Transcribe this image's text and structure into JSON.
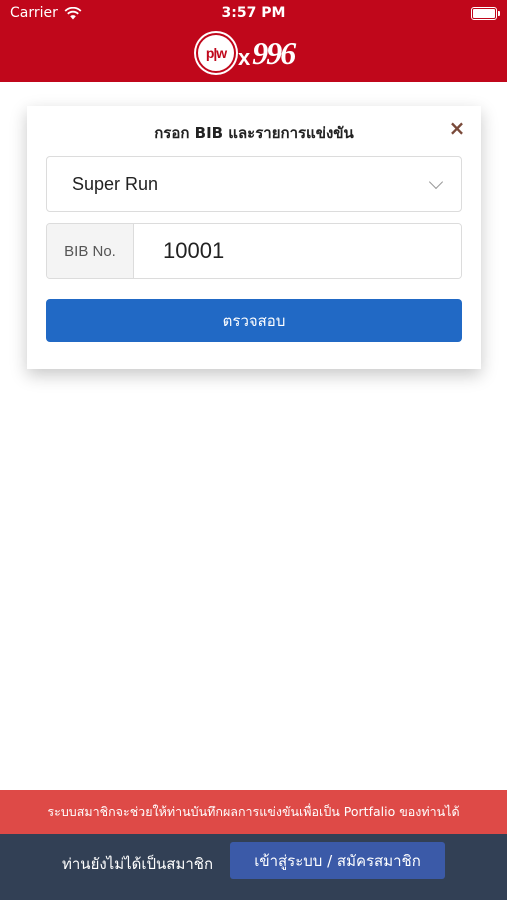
{
  "status_bar": {
    "carrier": "Carrier",
    "time": "3:57 PM"
  },
  "header": {
    "logo_left": "p|w",
    "logo_x": "x",
    "logo_right": "996",
    "brand_color": "#c0071b"
  },
  "dialog": {
    "title": "กรอก BIB และรายการแข่งขัน",
    "close_icon": "×",
    "race_select": {
      "selected": "Super Run"
    },
    "bib": {
      "label": "BIB No.",
      "value": "10001"
    },
    "check_button": "ตรวจสอบ",
    "accent_color": "#2169c5"
  },
  "info_banner": {
    "text": "ระบบสมาชิกจะช่วยให้ท่านบันทึกผลการแข่งขันเพื่อเป็น Portfalio ของท่านได้",
    "color": "#de4a47"
  },
  "footer": {
    "not_member_text": "ท่านยังไม่ได้เป็นสมาชิก",
    "login_button": "เข้าสู่ระบบ / สมัครสมาชิก",
    "background": "#324055"
  }
}
